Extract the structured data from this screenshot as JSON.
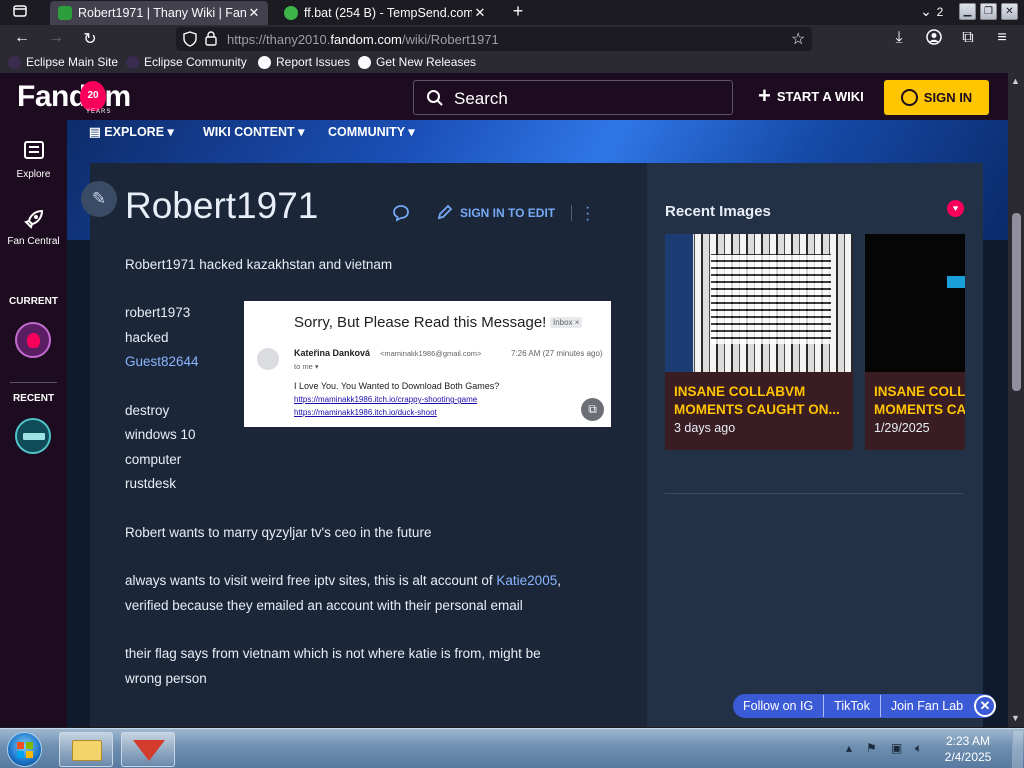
{
  "browser": {
    "tabs": [
      {
        "label": "Robert1971 | Thany Wiki | Fandom",
        "active": true
      },
      {
        "label": "ff.bat (254 B) - TempSend.com",
        "active": false
      }
    ],
    "tab_count": "2",
    "url_prefix": "https://thany2010.",
    "url_domain": "fandom.com",
    "url_path": "/wiki/Robert1971",
    "bookmarks": [
      "Eclipse Main Site",
      "Eclipse Community",
      "Report Issues",
      "Get New Releases"
    ]
  },
  "fandom": {
    "logo": "Fandom",
    "logo_badge": "20",
    "logo_sub": "YEARS",
    "search_placeholder": "Search",
    "start_wiki": "START A WIKI",
    "sign_in": "SIGN IN",
    "rail": {
      "explore": "Explore",
      "fan_central": "Fan Central",
      "current": "CURRENT",
      "recent": "RECENT"
    },
    "local_nav": [
      "EXPLORE",
      "WIKI CONTENT",
      "COMMUNITY"
    ]
  },
  "article": {
    "title": "Robert1971",
    "sign_in_to_edit": "SIGN IN TO EDIT",
    "p1": "Robert1971 hacked kazakhstan and vietnam",
    "list_lines": [
      "robert1973",
      "hacked",
      "Guest82644",
      "destroy",
      "windows 10",
      "computer",
      "rustdesk"
    ],
    "p2": "Robert wants to marry qyzyljar tv's ceo in the future",
    "p3_before": "always wants to visit weird free iptv sites, this is alt account of ",
    "p3_link": "Katie2005",
    "p3_after": ",",
    "p3_line2": "verified because they emailed an account with their personal email",
    "p4_line1": "their flag says from vietnam which is not where katie is from, might be",
    "p4_line2": "wrong person",
    "email": {
      "subject": "Sorry, But Please Read this Message!",
      "label": "Inbox ×",
      "from_name": "Kateřina Danková",
      "from_addr": "<maminakk1986@gmail.com>",
      "time": "7:26 AM (27 minutes ago)",
      "to": "to me ▾",
      "body": "I Love You. You Wanted to Download Both Games?",
      "url1": "https://maminakk1986.itch.io/crappy-shooting-game",
      "url2": "https://maminakk1986.itch.io/duck-shoot"
    }
  },
  "right_rail": {
    "title": "Recent Images",
    "cards": [
      {
        "title_line1": "INSANE COLLABVM",
        "title_line2": "MOMENTS CAUGHT ON...",
        "date": "3 days ago"
      },
      {
        "title_line1": "INSANE COLL",
        "title_line2": "MOMENTS CA",
        "date": "1/29/2025"
      }
    ]
  },
  "social_bar": [
    "Follow on IG",
    "TikTok",
    "Join Fan Lab"
  ],
  "taskbar": {
    "time": "2:23 AM",
    "date": "2/4/2025"
  },
  "colors": {
    "fandom_dark": "#1d0c1f",
    "accent_yellow": "#ffc500",
    "fandom_pink": "#fa005a",
    "link_blue": "#8ab4ff",
    "page_bg": "#1b2738"
  }
}
